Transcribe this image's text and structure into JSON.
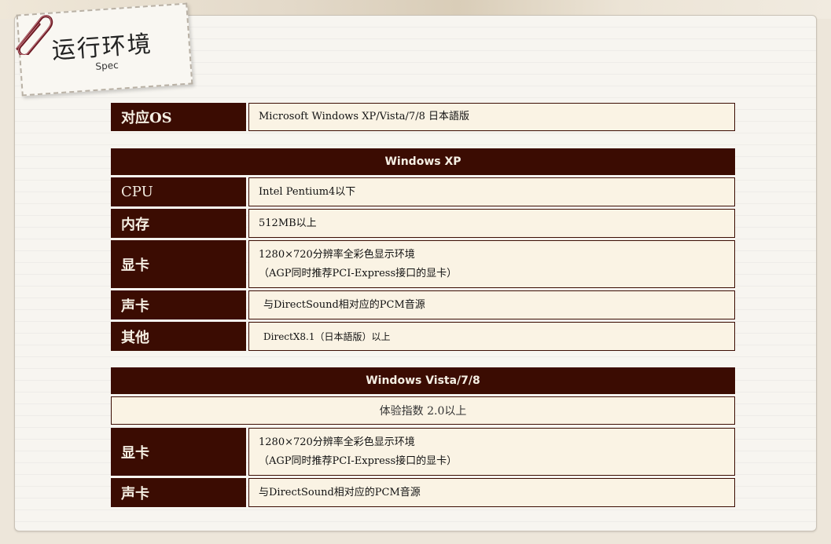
{
  "section": {
    "title": "运行环境",
    "subtitle": "Spec"
  },
  "os_row": {
    "label": "对应OS",
    "value": "Microsoft Windows XP/Vista/7/8 日本語版"
  },
  "xp": {
    "header": "Windows XP",
    "rows": [
      {
        "label": "CPU",
        "lines": [
          "Intel Pentium4以下"
        ]
      },
      {
        "label": "内存",
        "lines": [
          "512MB以上"
        ]
      },
      {
        "label": "显卡",
        "lines": [
          "1280×720分辨率全彩色显示环境",
          "（AGP同时推荐PCI-Express接口的显卡）"
        ]
      },
      {
        "label": "声卡",
        "lines": [
          "与DirectSound相对应的PCM音源"
        ]
      },
      {
        "label": "其他",
        "lines": [
          "DirectX8.1（日本語版）以上"
        ]
      }
    ]
  },
  "vista": {
    "header": "Windows Vista/7/8",
    "index_note": "体验指数 2.0以上",
    "rows": [
      {
        "label": "显卡",
        "lines": [
          "1280×720分辨率全彩色显示环境",
          "（AGP同时推荐PCI-Express接口的显卡）"
        ]
      },
      {
        "label": "声卡",
        "lines": [
          "与DirectSound相对应的PCM音源"
        ]
      }
    ]
  },
  "icons": {
    "stamp_clip": "paperclip-icon"
  },
  "colors": {
    "label_bg": "#3b0c02",
    "value_bg": "#faf3e4",
    "panel_bg": "#f7f5f0"
  }
}
